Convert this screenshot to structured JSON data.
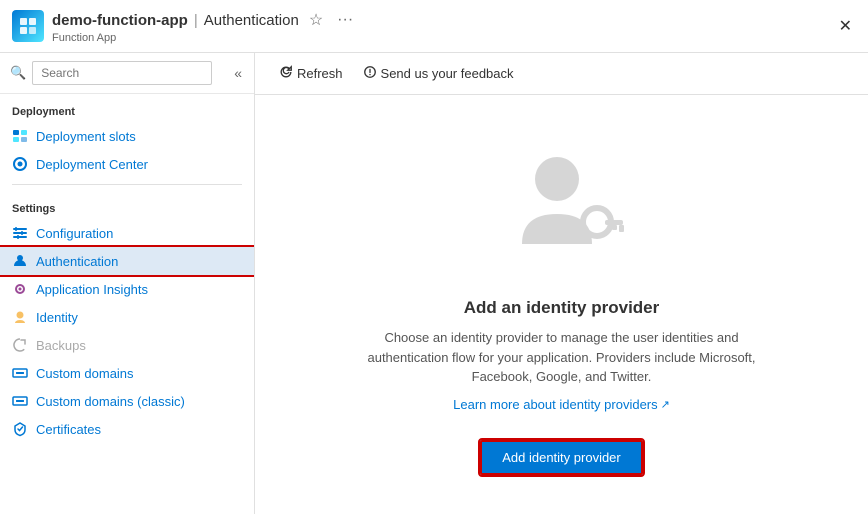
{
  "titleBar": {
    "appName": "demo-function-app",
    "separator": "|",
    "pageName": "Authentication",
    "subTitle": "Function App",
    "starIcon": "★",
    "moreIcon": "···",
    "closeIcon": "✕"
  },
  "sidebar": {
    "searchPlaceholder": "Search",
    "collapseIcon": "«",
    "sections": [
      {
        "label": "Deployment",
        "items": [
          {
            "id": "deployment-slots",
            "label": "Deployment slots",
            "iconColor": "#0078d4",
            "iconType": "deploy"
          },
          {
            "id": "deployment-center",
            "label": "Deployment Center",
            "iconColor": "#0078d4",
            "iconType": "deploy-center"
          }
        ]
      },
      {
        "label": "Settings",
        "items": [
          {
            "id": "configuration",
            "label": "Configuration",
            "iconColor": "#0078d4",
            "iconType": "config"
          },
          {
            "id": "authentication",
            "label": "Authentication",
            "iconColor": "#0078d4",
            "iconType": "auth",
            "active": true
          },
          {
            "id": "application-insights",
            "label": "Application Insights",
            "iconColor": "#9b4a97",
            "iconType": "insights"
          },
          {
            "id": "identity",
            "label": "Identity",
            "iconColor": "#f5a623",
            "iconType": "identity"
          },
          {
            "id": "backups",
            "label": "Backups",
            "iconColor": "#aaa",
            "iconType": "backup",
            "disabled": true
          },
          {
            "id": "custom-domains",
            "label": "Custom domains",
            "iconColor": "#0078d4",
            "iconType": "domain"
          },
          {
            "id": "custom-domains-classic",
            "label": "Custom domains (classic)",
            "iconColor": "#0078d4",
            "iconType": "domain"
          },
          {
            "id": "certificates",
            "label": "Certificates",
            "iconColor": "#0078d4",
            "iconType": "cert"
          }
        ]
      }
    ]
  },
  "toolbar": {
    "refreshLabel": "Refresh",
    "feedbackLabel": "Send us your feedback"
  },
  "content": {
    "title": "Add an identity provider",
    "description": "Choose an identity provider to manage the user identities and authentication flow for your application. Providers include Microsoft, Facebook, Google, and Twitter.",
    "learnMoreLabel": "Learn more about identity providers",
    "addButtonLabel": "Add identity provider"
  }
}
